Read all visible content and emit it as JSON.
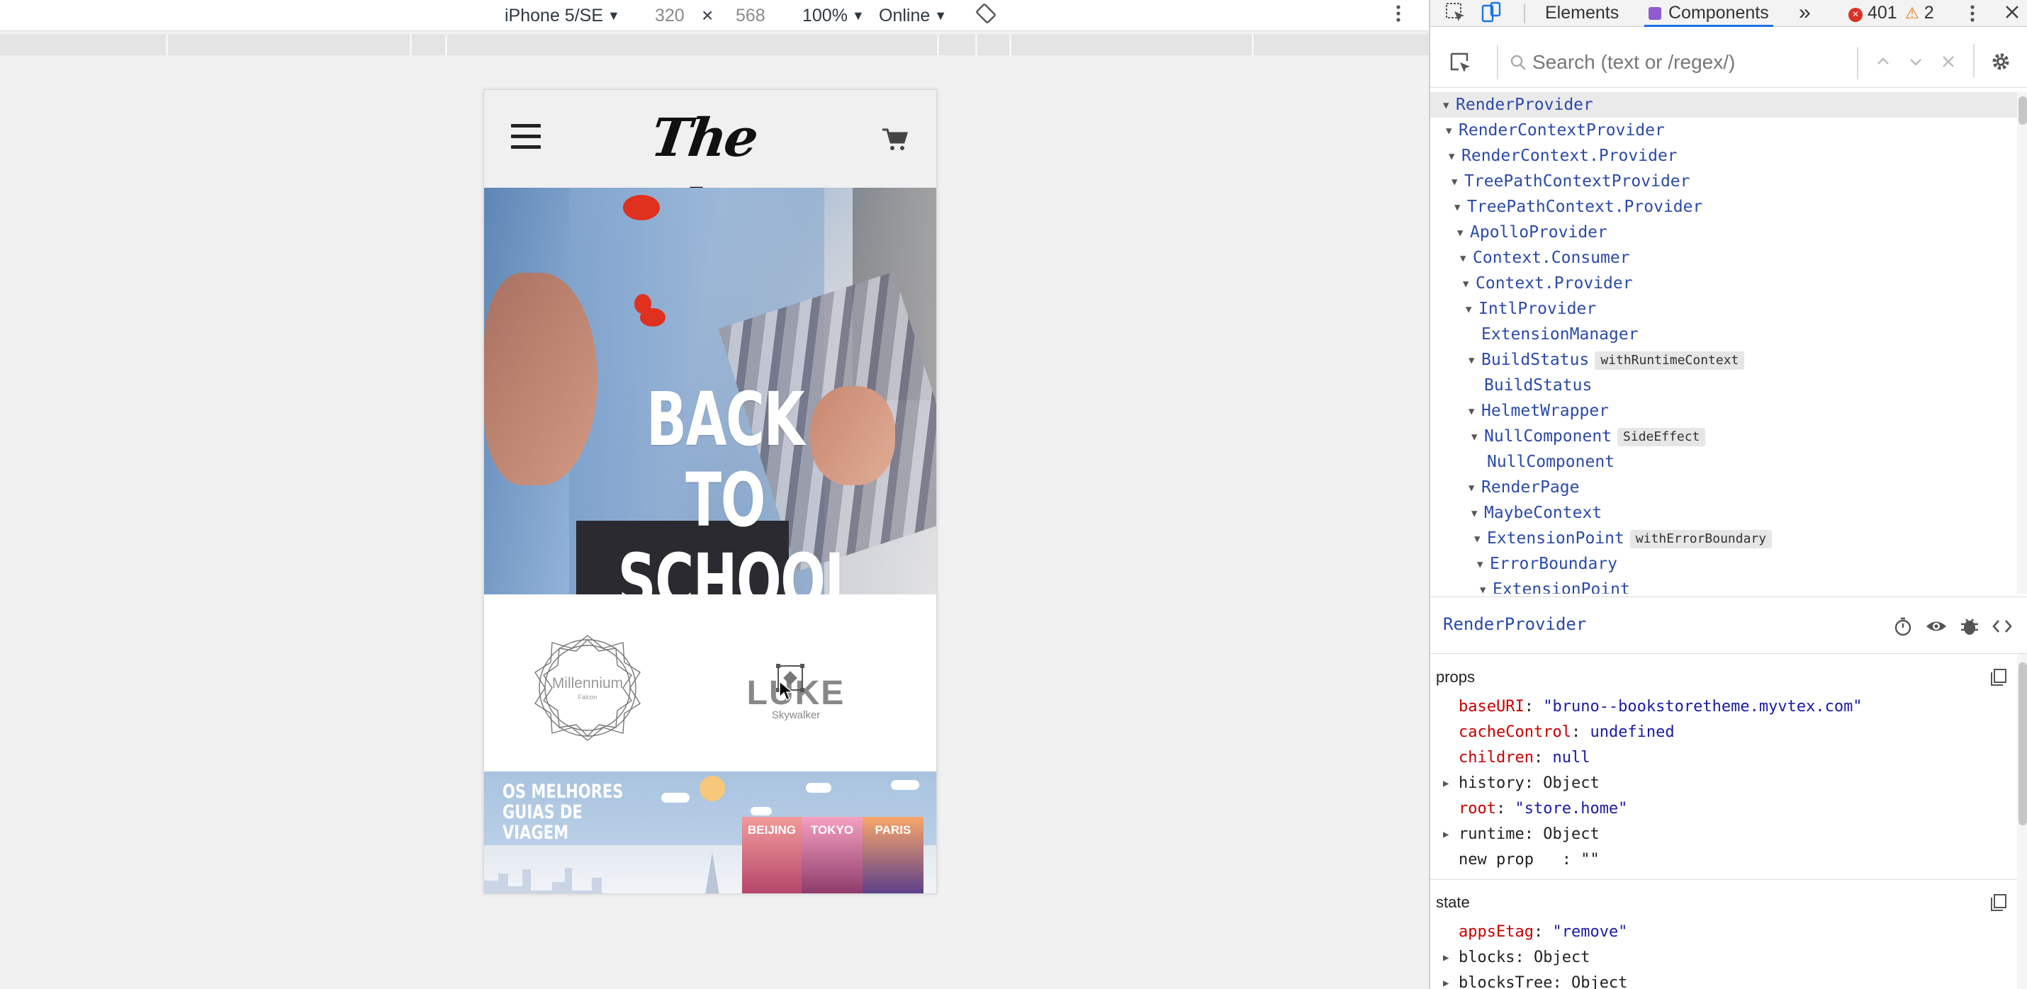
{
  "device_toolbar": {
    "device": "iPhone 5/SE",
    "width": "320",
    "times": "×",
    "height": "568",
    "zoom": "100%",
    "throttle": "Online"
  },
  "site": {
    "logo_text": "The Bookstore",
    "hero_title_line1": "BACK TO",
    "hero_title_line2": "SCHOOL",
    "brand1_name": "Millennium",
    "brand1_sub": "Falcon",
    "brand2_name": "LUKE",
    "brand2_sub": "Skywalker",
    "travel_title_line1": "OS MELHORES",
    "travel_title_line2": "GUIAS DE VIAGEM",
    "trip_cards": [
      {
        "label": "BEIJING"
      },
      {
        "label": "TOKYO"
      },
      {
        "label": "PARIS"
      }
    ]
  },
  "devtools": {
    "tabs": {
      "elements": "Elements",
      "components": "Components",
      "more": "»"
    },
    "errors_count": "401",
    "warnings_count": "2",
    "search_placeholder": "Search (text or /regex/)",
    "tree": [
      {
        "label": "RenderProvider",
        "depth": 0,
        "selected": true
      },
      {
        "label": "RenderContextProvider",
        "depth": 1
      },
      {
        "label": "RenderContext.Provider",
        "depth": 2
      },
      {
        "label": "TreePathContextProvider",
        "depth": 3
      },
      {
        "label": "TreePathContext.Provider",
        "depth": 4
      },
      {
        "label": "ApolloProvider",
        "depth": 5
      },
      {
        "label": "Context.Consumer",
        "depth": 6
      },
      {
        "label": "Context.Provider",
        "depth": 7
      },
      {
        "label": "IntlProvider",
        "depth": 8
      },
      {
        "label": "ExtensionManager",
        "depth": 9,
        "leaf": true
      },
      {
        "label": "BuildStatus",
        "depth": 9,
        "badge": "withRuntimeContext"
      },
      {
        "label": "BuildStatus",
        "depth": 10,
        "leaf": true
      },
      {
        "label": "HelmetWrapper",
        "depth": 9
      },
      {
        "label": "NullComponent",
        "depth": 10,
        "badge": "SideEffect"
      },
      {
        "label": "NullComponent",
        "depth": 11,
        "leaf": true
      },
      {
        "label": "RenderPage",
        "depth": 9
      },
      {
        "label": "MaybeContext",
        "depth": 10
      },
      {
        "label": "ExtensionPoint",
        "depth": 11,
        "badge": "withErrorBoundary"
      },
      {
        "label": "ErrorBoundary",
        "depth": 12
      },
      {
        "label": "ExtensionPoint",
        "depth": 13
      }
    ],
    "inspector": {
      "title": "RenderProvider",
      "props_title": "props",
      "props": [
        {
          "key": "baseURI",
          "value": "\"bruno--bookstoretheme.myvtex.com\""
        },
        {
          "key": "cacheControl",
          "value": "undefined"
        },
        {
          "key": "children",
          "value": "null"
        },
        {
          "key": "history",
          "value": "Object",
          "expandable": true
        },
        {
          "key": "root",
          "value": "\"store.home\""
        },
        {
          "key": "runtime",
          "value": "Object",
          "expandable": true
        },
        {
          "key": "new prop",
          "value": ": \"\"",
          "plain": true
        }
      ],
      "state_title": "state",
      "state": [
        {
          "key": "appsEtag",
          "value": "\"remove\""
        },
        {
          "key": "blocks",
          "value": "Object",
          "expandable": true
        },
        {
          "key": "blocksTree",
          "value": "Object",
          "expandable": true
        }
      ]
    }
  },
  "colors": {
    "component_name": "#2b4aa9",
    "prop_key": "#c80000",
    "prop_value": "#1a1aa6",
    "error": "#d93025",
    "warning": "#e8710a",
    "active_tab": "#1a73e8"
  }
}
